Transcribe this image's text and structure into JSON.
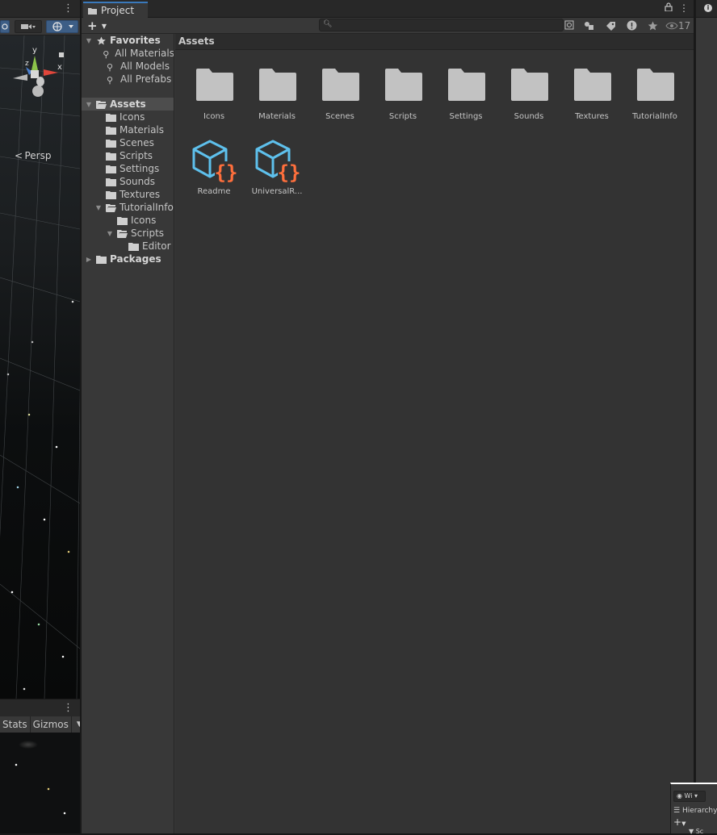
{
  "scene": {
    "persp_label": "Persp",
    "gizmo": {
      "y": "y",
      "x": "x",
      "z": "z"
    },
    "bottom_toolbar": {
      "stats": "Stats",
      "gizmos": "Gizmos"
    },
    "icons": [
      "kebab-menu-icon",
      "camera-icon",
      "gizmo-globe-icon",
      "lock-icon"
    ]
  },
  "project": {
    "tab_label": "Project",
    "add_button": "+",
    "search": {
      "placeholder": "",
      "value": ""
    },
    "hidden_count": "17",
    "tree": {
      "favorites": {
        "label": "Favorites",
        "items": [
          "All Materials",
          "All Models",
          "All Prefabs"
        ]
      },
      "assets": {
        "label": "Assets",
        "children": [
          "Icons",
          "Materials",
          "Scenes",
          "Scripts",
          "Settings",
          "Sounds",
          "Textures",
          "TutorialInfo"
        ],
        "tutorialinfo_children": [
          "Icons",
          "Scripts"
        ],
        "scripts_children": [
          "Editor"
        ]
      },
      "packages": {
        "label": "Packages"
      }
    },
    "breadcrumb": "Assets",
    "folders": [
      "Icons",
      "Materials",
      "Scenes",
      "Scripts",
      "Settings",
      "Sounds",
      "Textures",
      "TutorialInfo"
    ],
    "assets": [
      "Readme",
      "UniversalR..."
    ]
  },
  "hierarchy_mini": {
    "tab_label": "Hierarchy",
    "add_button": "+",
    "dropdown": "Wi",
    "scene_row": "Sc"
  },
  "colors": {
    "accent": "#3a79bb",
    "folder": "#c2c2c2",
    "script_cube": "#5ec0ec",
    "script_braces": "#ff6f3c"
  }
}
